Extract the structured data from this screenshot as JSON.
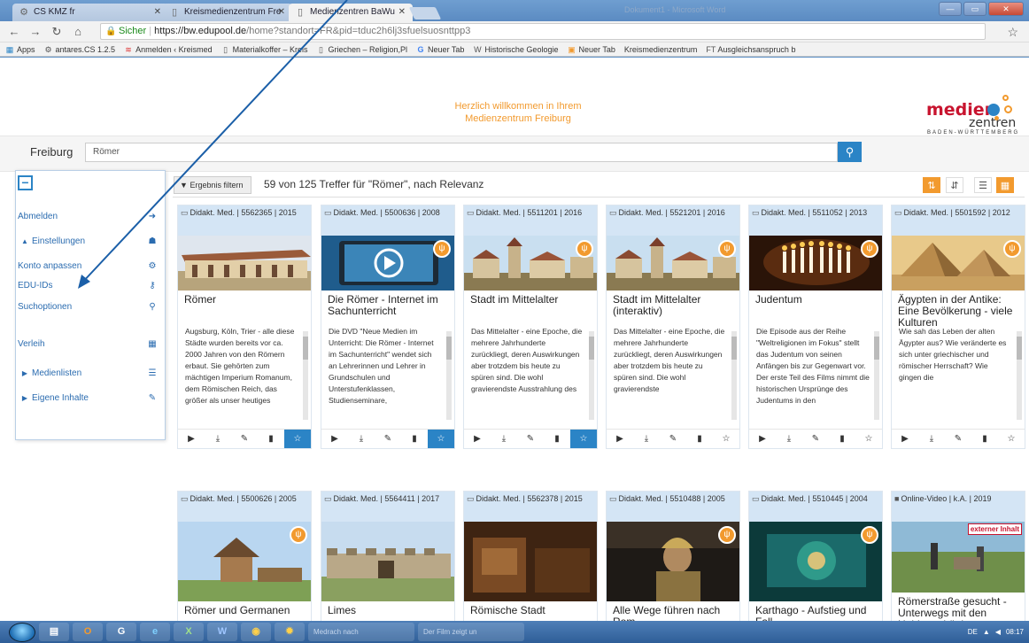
{
  "browser": {
    "tabs": [
      {
        "label": "CS KMZ fr",
        "icon": "gear-icon",
        "active": false
      },
      {
        "label": "Kreismedienzentrum Fre",
        "icon": "page-icon",
        "active": false
      },
      {
        "label": "Medienzentren BaWu",
        "icon": "page-icon",
        "active": true
      }
    ],
    "window_ghost": "Dokument1 - Microsoft Word",
    "address": {
      "secure": "Sicher",
      "host": "https://bw.edupool.de",
      "path": "/home?standort=FR&pid=tduc2h6lj3sfuelsuosnttpp3"
    },
    "bookmarks": [
      "Apps",
      "antares.CS 1.2.5",
      "Anmelden ‹ Kreismed",
      "Materialkoffer – Kreis",
      "Griechen – Religion,Pl",
      "Neuer Tab",
      "Historische Geologie",
      "Neuer Tab",
      "Kreismedienzentrum",
      "Ausgleichsanspruch b"
    ]
  },
  "page": {
    "welcome_line1": "Herzlich willkommen in Ihrem",
    "welcome_line2": "Medienzentrum Freiburg",
    "logo": {
      "word1": "medien",
      "word2": "zentren",
      "tagline": "BADEN-WÜRTTEMBERG"
    },
    "location": "Freiburg",
    "search_value": "Römer",
    "sidebar": {
      "logout": "Abmelden",
      "settings": "Einstellungen",
      "account": "Konto anpassen",
      "eduids": "EDU-IDs",
      "search_options": "Suchoptionen",
      "lending": "Verleih",
      "media_lists": "Medienlisten",
      "own_content": "Eigene Inhalte"
    },
    "results": {
      "filter_label": "Ergebnis filtern",
      "count_text": "59 von 125 Treffer für \"Römer\", nach Relevanz"
    },
    "cards_row1": [
      {
        "meta": "Didakt. Med. | 5562365 | 2015",
        "title": "Römer",
        "desc": "Augsburg, Köln, Trier - alle diese Städte wurden bereits vor ca. 2000 Jahren von den Römern erbaut. Sie gehörten zum mächtigen Imperium Romanum, dem Römischen Reich, das größer als unser heutiges",
        "fwu": false,
        "fav": false
      },
      {
        "meta": "Didakt. Med. | 5500636 | 2008",
        "title": "Die Römer - Internet im Sachunterricht",
        "desc": "Die DVD \"Neue Medien im Unterricht: Die Römer - Internet im Sachunterricht\" wendet sich an Lehrerinnen und Lehrer in Grundschulen und Unterstufenklassen, Studienseminare,",
        "fwu": true,
        "fav": true
      },
      {
        "meta": "Didakt. Med. | 5511201 | 2016",
        "title": "Stadt im Mittelalter",
        "desc": "Das Mittelalter - eine Epoche, die mehrere Jahrhunderte zurückliegt, deren Auswirkungen aber trotzdem bis heute zu spüren sind. Die wohl gravierendste Ausstrahlung des",
        "fwu": true,
        "fav": true
      },
      {
        "meta": "Didakt. Med. | 5521201 | 2016",
        "title": "Stadt im Mittelalter (interaktiv)",
        "desc": "Das Mittelalter - eine Epoche, die mehrere Jahrhunderte zurückliegt, deren Auswirkungen aber trotzdem bis heute zu spüren sind. Die wohl gravierendste",
        "fwu": true,
        "fav": false
      },
      {
        "meta": "Didakt. Med. | 5511052 | 2013",
        "title": "Judentum",
        "desc": "Die Episode aus der Reihe \"Weltreligionen im Fokus\" stellt das Judentum von seinen Anfängen bis zur Gegenwart vor. Der erste Teil des Films nimmt die historischen Ursprünge des Judentums in den",
        "fwu": true,
        "fav": false
      },
      {
        "meta": "Didakt. Med. | 5501592 | 2012",
        "title": "Ägypten in der Antike: Eine Bevölkerung - viele Kulturen",
        "desc": "Wie sah das Leben der alten Ägypter aus? Wie veränderte es sich unter griechischer und römischer Herrschaft? Wie gingen die",
        "fwu": true,
        "fav": false
      }
    ],
    "cards_row2": [
      {
        "meta": "Didakt. Med. | 5500626 | 2005",
        "title": "Römer und Germanen",
        "fwu": true
      },
      {
        "meta": "Didakt. Med. | 5564411 | 2017",
        "title": "Limes",
        "fwu": false
      },
      {
        "meta": "Didakt. Med. | 5562378 | 2015",
        "title": "Römische Stadt",
        "fwu": false
      },
      {
        "meta": "Didakt. Med. | 5510488 | 2005",
        "title": "Alle Wege führen nach Rom",
        "fwu": true
      },
      {
        "meta": "Didakt. Med. | 5510445 | 2004",
        "title": "Karthago - Aufstieg und Fall",
        "fwu": true
      },
      {
        "meta": "Online-Video | k.A. | 2019",
        "title": "Römerstraße gesucht - Unterwegs mit den Hobbyarchäologen",
        "fwu": false,
        "badge": "externer Inhalt"
      }
    ]
  },
  "taskbar": {
    "windows": [
      "Medrach nach",
      "Der Film zeigt un"
    ],
    "tray_lang": "DE",
    "time": "08:17"
  },
  "colors": {
    "accent_orange": "#f29a2e",
    "accent_blue": "#2b84c6",
    "meta_bg": "#d4e5f5",
    "logo_red": "#c8142f"
  }
}
